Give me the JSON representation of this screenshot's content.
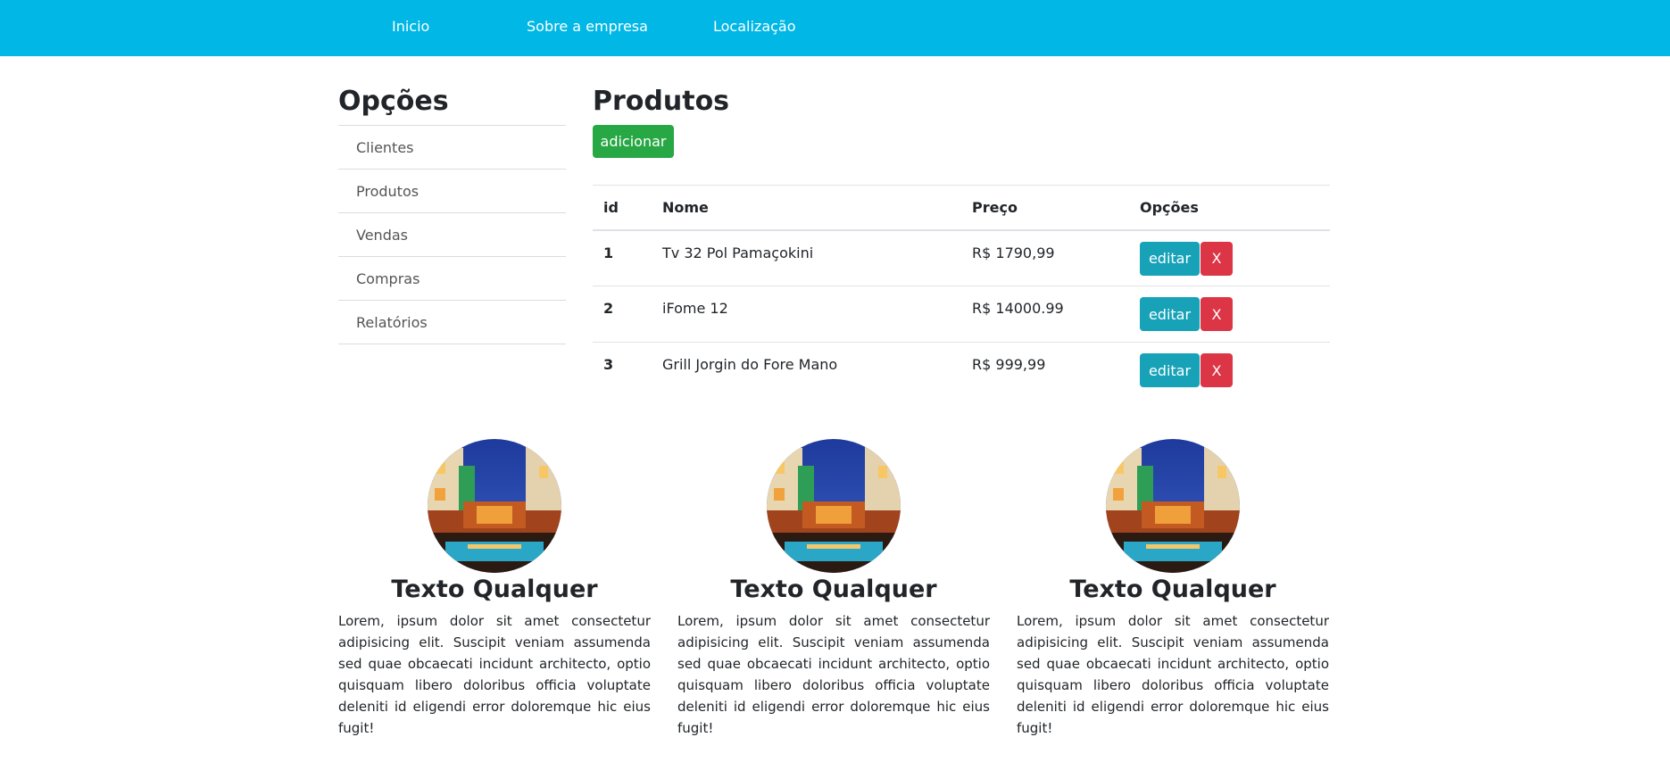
{
  "nav": {
    "items": [
      {
        "label": "Inicio"
      },
      {
        "label": "Sobre a empresa"
      },
      {
        "label": "Localização"
      }
    ]
  },
  "colors": {
    "nav_bg": "#00b7e6",
    "add_button": "#28a745",
    "edit_button": "#17a2b8",
    "delete_button": "#dc3545"
  },
  "sidebar": {
    "title": "Opções",
    "items": [
      {
        "label": "Clientes"
      },
      {
        "label": "Produtos"
      },
      {
        "label": "Vendas"
      },
      {
        "label": "Compras"
      },
      {
        "label": "Relatórios"
      }
    ]
  },
  "main": {
    "title": "Produtos",
    "add_label": "adicionar",
    "table": {
      "headers": [
        "id",
        "Nome",
        "Preço",
        "Opções"
      ],
      "rows": [
        {
          "id": "1",
          "name": "Tv 32 Pol Pamaçokini",
          "price": "R$ 1790,99",
          "edit_label": "editar",
          "delete_label": "X"
        },
        {
          "id": "2",
          "name": "iFome 12",
          "price": "R$ 14000.99",
          "edit_label": "editar",
          "delete_label": "X"
        },
        {
          "id": "3",
          "name": "Grill Jorgin do Fore Mano",
          "price": "R$ 999,99",
          "edit_label": "editar",
          "delete_label": "X"
        }
      ]
    }
  },
  "cards": [
    {
      "image": "resort-pool-night-photo",
      "title": "Texto Qualquer",
      "text": "Lorem, ipsum dolor sit amet consectetur adipisicing elit. Suscipit veniam assumenda sed quae obcaecati incidunt architecto, optio quisquam libero doloribus officia voluptate deleniti id eligendi error doloremque hic eius fugit!"
    },
    {
      "image": "resort-pool-night-photo",
      "title": "Texto Qualquer",
      "text": "Lorem, ipsum dolor sit amet consectetur adipisicing elit. Suscipit veniam assumenda sed quae obcaecati incidunt architecto, optio quisquam libero doloribus officia voluptate deleniti id eligendi error doloremque hic eius fugit!"
    },
    {
      "image": "resort-pool-night-photo",
      "title": "Texto Qualquer",
      "text": "Lorem, ipsum dolor sit amet consectetur adipisicing elit. Suscipit veniam assumenda sed quae obcaecati incidunt architecto, optio quisquam libero doloribus officia voluptate deleniti id eligendi error doloremque hic eius fugit!"
    }
  ]
}
